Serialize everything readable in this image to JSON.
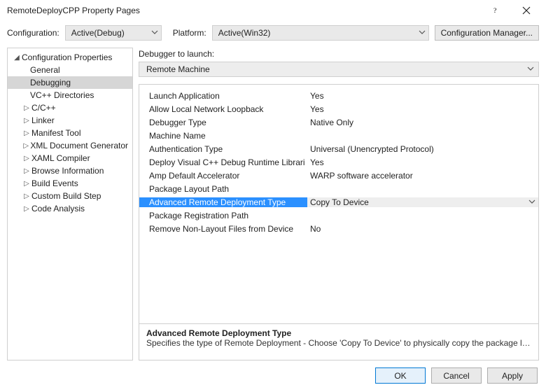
{
  "window": {
    "title": "RemoteDeployCPP Property Pages"
  },
  "configRow": {
    "configurationLabel": "Configuration:",
    "configurationValue": "Active(Debug)",
    "platformLabel": "Platform:",
    "platformValue": "Active(Win32)",
    "managerButton": "Configuration Manager..."
  },
  "tree": {
    "root": "Configuration Properties",
    "items": [
      {
        "label": "General",
        "indent": 32,
        "expand": ""
      },
      {
        "label": "Debugging",
        "indent": 32,
        "expand": "",
        "selected": true
      },
      {
        "label": "VC++ Directories",
        "indent": 32,
        "expand": ""
      },
      {
        "label": "C/C++",
        "indent": 22,
        "expand": "▷"
      },
      {
        "label": "Linker",
        "indent": 22,
        "expand": "▷"
      },
      {
        "label": "Manifest Tool",
        "indent": 22,
        "expand": "▷"
      },
      {
        "label": "XML Document Generator",
        "indent": 22,
        "expand": "▷"
      },
      {
        "label": "XAML Compiler",
        "indent": 22,
        "expand": "▷"
      },
      {
        "label": "Browse Information",
        "indent": 22,
        "expand": "▷"
      },
      {
        "label": "Build Events",
        "indent": 22,
        "expand": "▷"
      },
      {
        "label": "Custom Build Step",
        "indent": 22,
        "expand": "▷"
      },
      {
        "label": "Code Analysis",
        "indent": 22,
        "expand": "▷"
      }
    ]
  },
  "launcher": {
    "label": "Debugger to launch:",
    "value": "Remote Machine"
  },
  "properties": [
    {
      "name": "Launch Application",
      "value": "Yes"
    },
    {
      "name": "Allow Local Network Loopback",
      "value": "Yes"
    },
    {
      "name": "Debugger Type",
      "value": "Native Only"
    },
    {
      "name": "Machine Name",
      "value": ""
    },
    {
      "name": "Authentication Type",
      "value": "Universal (Unencrypted Protocol)"
    },
    {
      "name": "Deploy Visual C++ Debug Runtime Librari",
      "value": "Yes"
    },
    {
      "name": "Amp Default Accelerator",
      "value": "WARP software accelerator"
    },
    {
      "name": "Package Layout Path",
      "value": ""
    },
    {
      "name": "Advanced Remote Deployment Type",
      "value": "Copy To Device",
      "selected": true,
      "hasDropdown": true
    },
    {
      "name": "Package Registration Path",
      "value": ""
    },
    {
      "name": "Remove Non-Layout Files from Device",
      "value": "No"
    }
  ],
  "description": {
    "title": "Advanced Remote Deployment Type",
    "body": "Specifies the type of Remote Deployment - Choose 'Copy To Device' to physically copy the package layout to re..."
  },
  "buttons": {
    "ok": "OK",
    "cancel": "Cancel",
    "apply": "Apply"
  }
}
